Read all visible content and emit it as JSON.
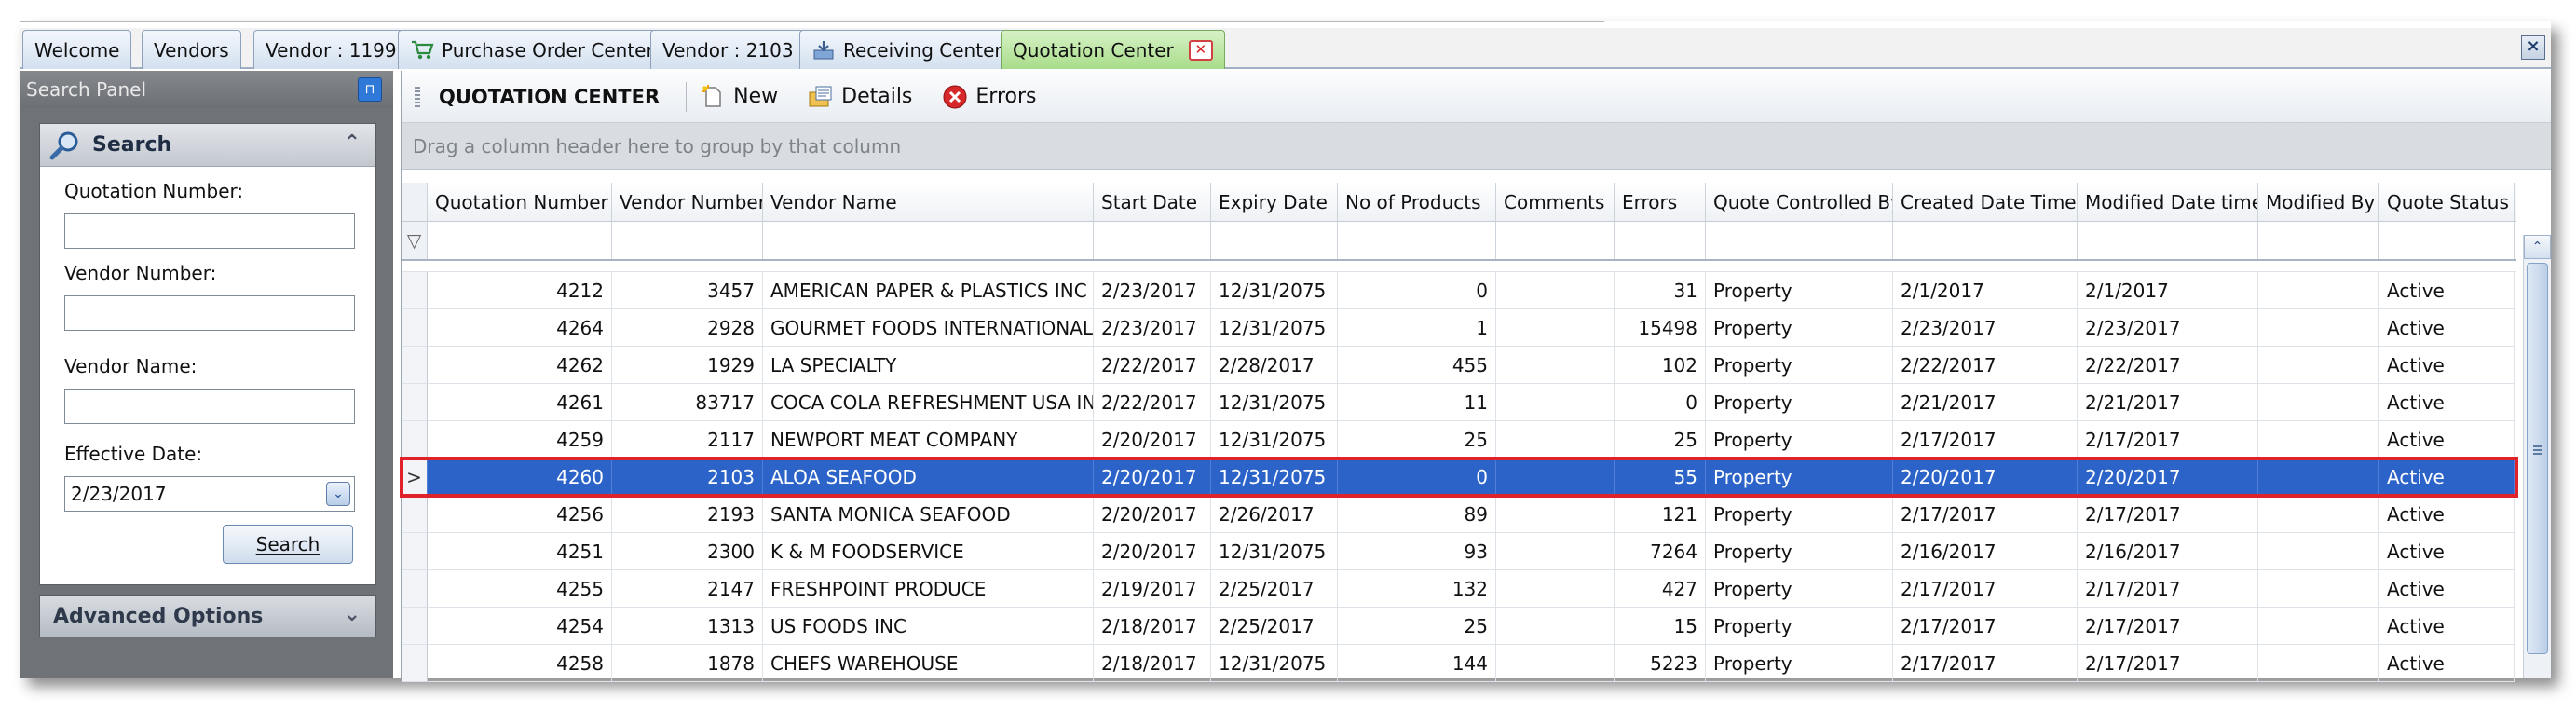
{
  "tabs": [
    {
      "label": "Welcome",
      "icon": null,
      "active": false
    },
    {
      "label": "Vendors",
      "icon": null,
      "active": false
    },
    {
      "label": "Vendor : 1199",
      "icon": null,
      "active": false
    },
    {
      "label": "Purchase Order Center",
      "icon": "cart-icon",
      "active": false
    },
    {
      "label": "Vendor : 2103",
      "icon": null,
      "active": false
    },
    {
      "label": "Receiving Center",
      "icon": "receiving-icon",
      "active": false
    },
    {
      "label": "Quotation Center",
      "icon": null,
      "active": true
    }
  ],
  "window_close": "×",
  "search_panel": {
    "title": "Search Panel",
    "section_title": "Search",
    "quotation_number_label": "Quotation Number:",
    "quotation_number_value": "",
    "vendor_number_label": "Vendor Number:",
    "vendor_number_value": "",
    "vendor_name_label": "Vendor Name:",
    "vendor_name_value": "",
    "effective_date_label": "Effective Date:",
    "effective_date_value": "2/23/2017",
    "search_button": "Search",
    "advanced_options": "Advanced Options"
  },
  "toolbar": {
    "title": "QUOTATION CENTER",
    "new_label": "New",
    "details_label": "Details",
    "errors_label": "Errors"
  },
  "group_hint": "Drag a column header here to group by that column",
  "grid": {
    "columns": [
      "Quotation Number",
      "Vendor Number",
      "Vendor Name",
      "Start Date",
      "Expiry Date",
      "No of Products",
      "Comments",
      "Errors",
      "Quote Controlled By",
      "Created Date Time",
      "Modified Date time",
      "Modified By",
      "Quote Status"
    ],
    "rows": [
      [
        "4212",
        "3457",
        "AMERICAN PAPER & PLASTICS INC",
        "2/23/2017",
        "12/31/2075",
        "0",
        "",
        "31",
        "Property",
        "2/1/2017",
        "2/1/2017",
        "",
        "Active"
      ],
      [
        "4264",
        "2928",
        "GOURMET FOODS INTERNATIONAL",
        "2/23/2017",
        "12/31/2075",
        "1",
        "",
        "15498",
        "Property",
        "2/23/2017",
        "2/23/2017",
        "",
        "Active"
      ],
      [
        "4262",
        "1929",
        "LA SPECIALTY",
        "2/22/2017",
        "2/28/2017",
        "455",
        "",
        "102",
        "Property",
        "2/22/2017",
        "2/22/2017",
        "",
        "Active"
      ],
      [
        "4261",
        "83717",
        "COCA COLA REFRESHMENT USA INC",
        "2/22/2017",
        "12/31/2075",
        "11",
        "",
        "0",
        "Property",
        "2/21/2017",
        "2/21/2017",
        "",
        "Active"
      ],
      [
        "4259",
        "2117",
        "NEWPORT MEAT COMPANY",
        "2/20/2017",
        "12/31/2075",
        "25",
        "",
        "25",
        "Property",
        "2/17/2017",
        "2/17/2017",
        "",
        "Active"
      ],
      [
        "4260",
        "2103",
        "ALOA SEAFOOD",
        "2/20/2017",
        "12/31/2075",
        "0",
        "",
        "55",
        "Property",
        "2/20/2017",
        "2/20/2017",
        "",
        "Active"
      ],
      [
        "4256",
        "2193",
        "SANTA MONICA SEAFOOD",
        "2/20/2017",
        "2/26/2017",
        "89",
        "",
        "121",
        "Property",
        "2/17/2017",
        "2/17/2017",
        "",
        "Active"
      ],
      [
        "4251",
        "2300",
        "K & M FOODSERVICE",
        "2/20/2017",
        "12/31/2075",
        "93",
        "",
        "7264",
        "Property",
        "2/16/2017",
        "2/16/2017",
        "",
        "Active"
      ],
      [
        "4255",
        "2147",
        "FRESHPOINT PRODUCE",
        "2/19/2017",
        "2/25/2017",
        "132",
        "",
        "427",
        "Property",
        "2/17/2017",
        "2/17/2017",
        "",
        "Active"
      ],
      [
        "4254",
        "1313",
        "US FOODS INC",
        "2/18/2017",
        "2/25/2017",
        "25",
        "",
        "15",
        "Property",
        "2/17/2017",
        "2/17/2017",
        "",
        "Active"
      ],
      [
        "4258",
        "1878",
        "CHEFS WAREHOUSE",
        "2/18/2017",
        "12/31/2075",
        "144",
        "",
        "5223",
        "Property",
        "2/17/2017",
        "2/17/2017",
        "",
        "Active"
      ]
    ],
    "selected_row_index": 5,
    "selected_indicator": ">",
    "filter_icon": "▽"
  },
  "colors": {
    "selection": "#2b63c9",
    "highlight_outline": "#e0222a",
    "active_tab": "#a8dc8a"
  }
}
